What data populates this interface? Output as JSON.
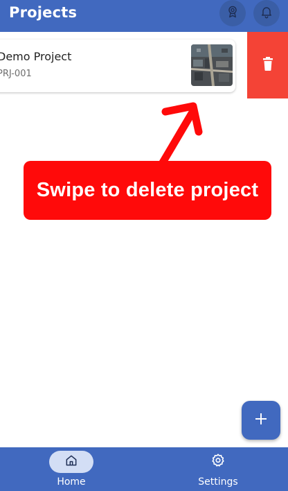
{
  "app_bar": {
    "title": "Projects",
    "actions": [
      {
        "icon": "award-icon"
      },
      {
        "icon": "bell-icon"
      }
    ],
    "color": "#4169bf"
  },
  "project_list": {
    "items": [
      {
        "name": "Demo Project",
        "code": "PRJ-001",
        "thumbnail_icon": "aerial-photo-thumbnail"
      }
    ]
  },
  "swipe_action": {
    "icon": "trash-icon",
    "color": "#f44336"
  },
  "hint": {
    "text": "Swipe to delete project",
    "color": "#ff0a0a"
  },
  "fab": {
    "icon": "plus-icon"
  },
  "bottom_nav": {
    "items": [
      {
        "label": "Home",
        "icon": "home-icon",
        "selected": true
      },
      {
        "label": "Settings",
        "icon": "gear-icon",
        "selected": false
      }
    ]
  }
}
